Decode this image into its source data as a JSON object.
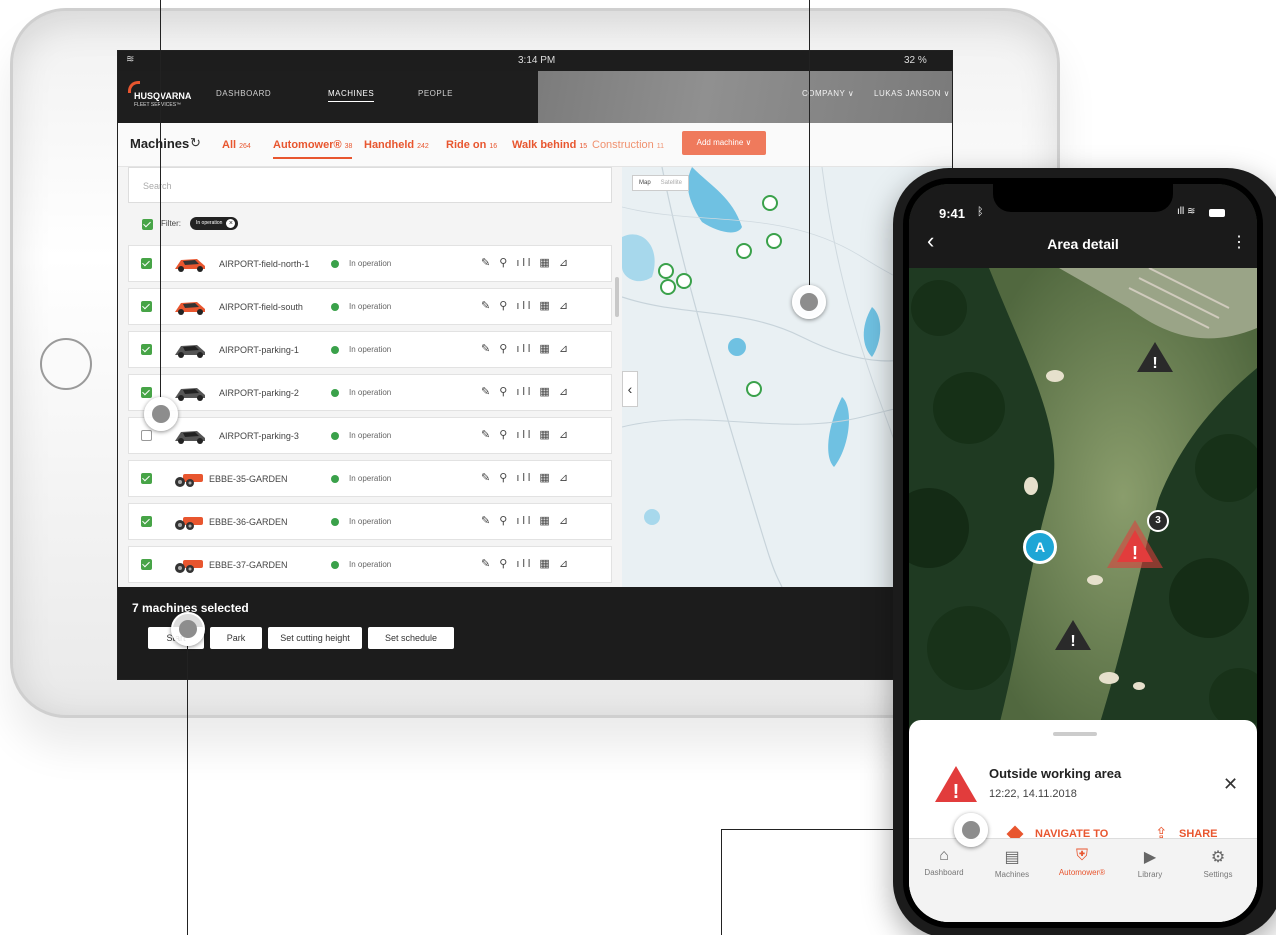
{
  "tablet": {
    "status": {
      "time": "3:14 PM",
      "battery": "32 %"
    },
    "brand": {
      "name": "HUSQVARNA",
      "sub": "FLEET SERVICES™"
    },
    "nav": {
      "dashboard": "DASHBOARD",
      "machines": "MACHINES",
      "people": "PEOPLE",
      "company": "COMPANY ∨",
      "user": "LUKAS JANSON ∨"
    },
    "subnav": {
      "title": "Machines",
      "tabs": [
        {
          "label": "All",
          "count": "264"
        },
        {
          "label": "Automower®",
          "count": "38"
        },
        {
          "label": "Handheld",
          "count": "242"
        },
        {
          "label": "Ride on",
          "count": "16"
        },
        {
          "label": "Walk behind",
          "count": "15"
        },
        {
          "label": "Construction",
          "count": "11"
        }
      ],
      "add_label": "Add machine ∨"
    },
    "search_placeholder": "Search",
    "filter_label": "Filter:",
    "filter_chip": "In operation",
    "rows": [
      {
        "name": "AIRPORT-field-north-1",
        "status": "In operation",
        "checked": true
      },
      {
        "name": "AIRPORT-field-south",
        "status": "In operation",
        "checked": true
      },
      {
        "name": "AIRPORT-parking-1",
        "status": "In operation",
        "checked": true
      },
      {
        "name": "AIRPORT-parking-2",
        "status": "In operation",
        "checked": true
      },
      {
        "name": "AIRPORT-parking-3",
        "status": "In operation",
        "checked": false
      },
      {
        "name": "EBBE-35-GARDEN",
        "status": "In operation",
        "checked": true
      },
      {
        "name": "EBBE-36-GARDEN",
        "status": "In operation",
        "checked": true
      },
      {
        "name": "EBBE-37-GARDEN",
        "status": "In operation",
        "checked": true
      }
    ],
    "row_icons": "✎ ⚲ ıll ▦ ⊿",
    "map_tabs": {
      "map": "Map",
      "satellite": "Satellite"
    },
    "selection": {
      "text": "7 machines selected",
      "buttons": [
        "Start",
        "Park",
        "Set cutting height",
        "Set schedule"
      ]
    },
    "colors": {
      "accent": "#e8562f",
      "status_green": "#3aa14a",
      "dark": "#1e1e1e"
    }
  },
  "phone": {
    "time": "9:41",
    "title": "Area detail",
    "alert_badge": "3",
    "marker_label": "A",
    "alert_title": "Outside working area",
    "alert_time": "12:22, 14.11.2018",
    "navigate_label": "NAVIGATE TO",
    "share_label": "SHARE",
    "tabs": [
      {
        "icon": "⌂",
        "label": "Dashboard"
      },
      {
        "icon": "▤",
        "label": "Machines"
      },
      {
        "icon": "⛨",
        "label": "Automower®"
      },
      {
        "icon": "▶",
        "label": "Library"
      },
      {
        "icon": "⚙",
        "label": "Settings"
      }
    ]
  }
}
